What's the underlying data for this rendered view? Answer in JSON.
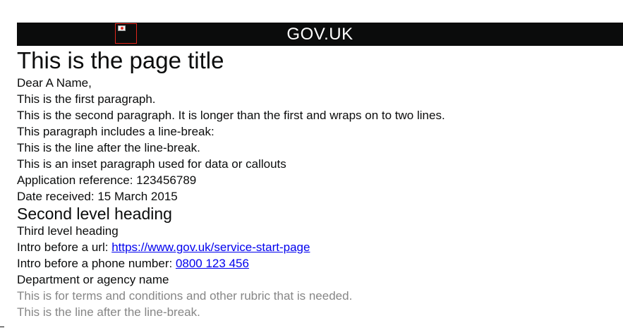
{
  "header": {
    "brand": "GOV.UK",
    "logo_image": "broken-image-icon"
  },
  "page": {
    "title": "This is the page title",
    "salutation": "Dear A Name,",
    "paragraph_1": "This is the first paragraph.",
    "paragraph_2": "This is the second paragraph. It is longer than the first and wraps on to two lines.",
    "paragraph_3": "This paragraph includes a line-break:",
    "paragraph_3_after_break": "This is the line after the line-break.",
    "inset_paragraph": "This is an inset paragraph used for data or callouts",
    "application_reference": "Application reference: 123456789",
    "date_received": "Date received: 15 March 2015",
    "second_heading": "Second level heading",
    "third_heading": "Third level heading",
    "url_intro": "Intro before a url: ",
    "url_link": "https://www.gov.uk/service-start-page",
    "phone_intro": "Intro before a phone number: ",
    "phone_link": "0800 123 456",
    "department": "Department or agency name",
    "rubric_1": "This is for terms and conditions and other rubric that is needed.",
    "rubric_2": "This is the line after the line-break."
  },
  "colors": {
    "header_background": "#0b0c0c",
    "text": "#0b0c0c",
    "link": "#0000ee",
    "rubric": "#868686"
  }
}
